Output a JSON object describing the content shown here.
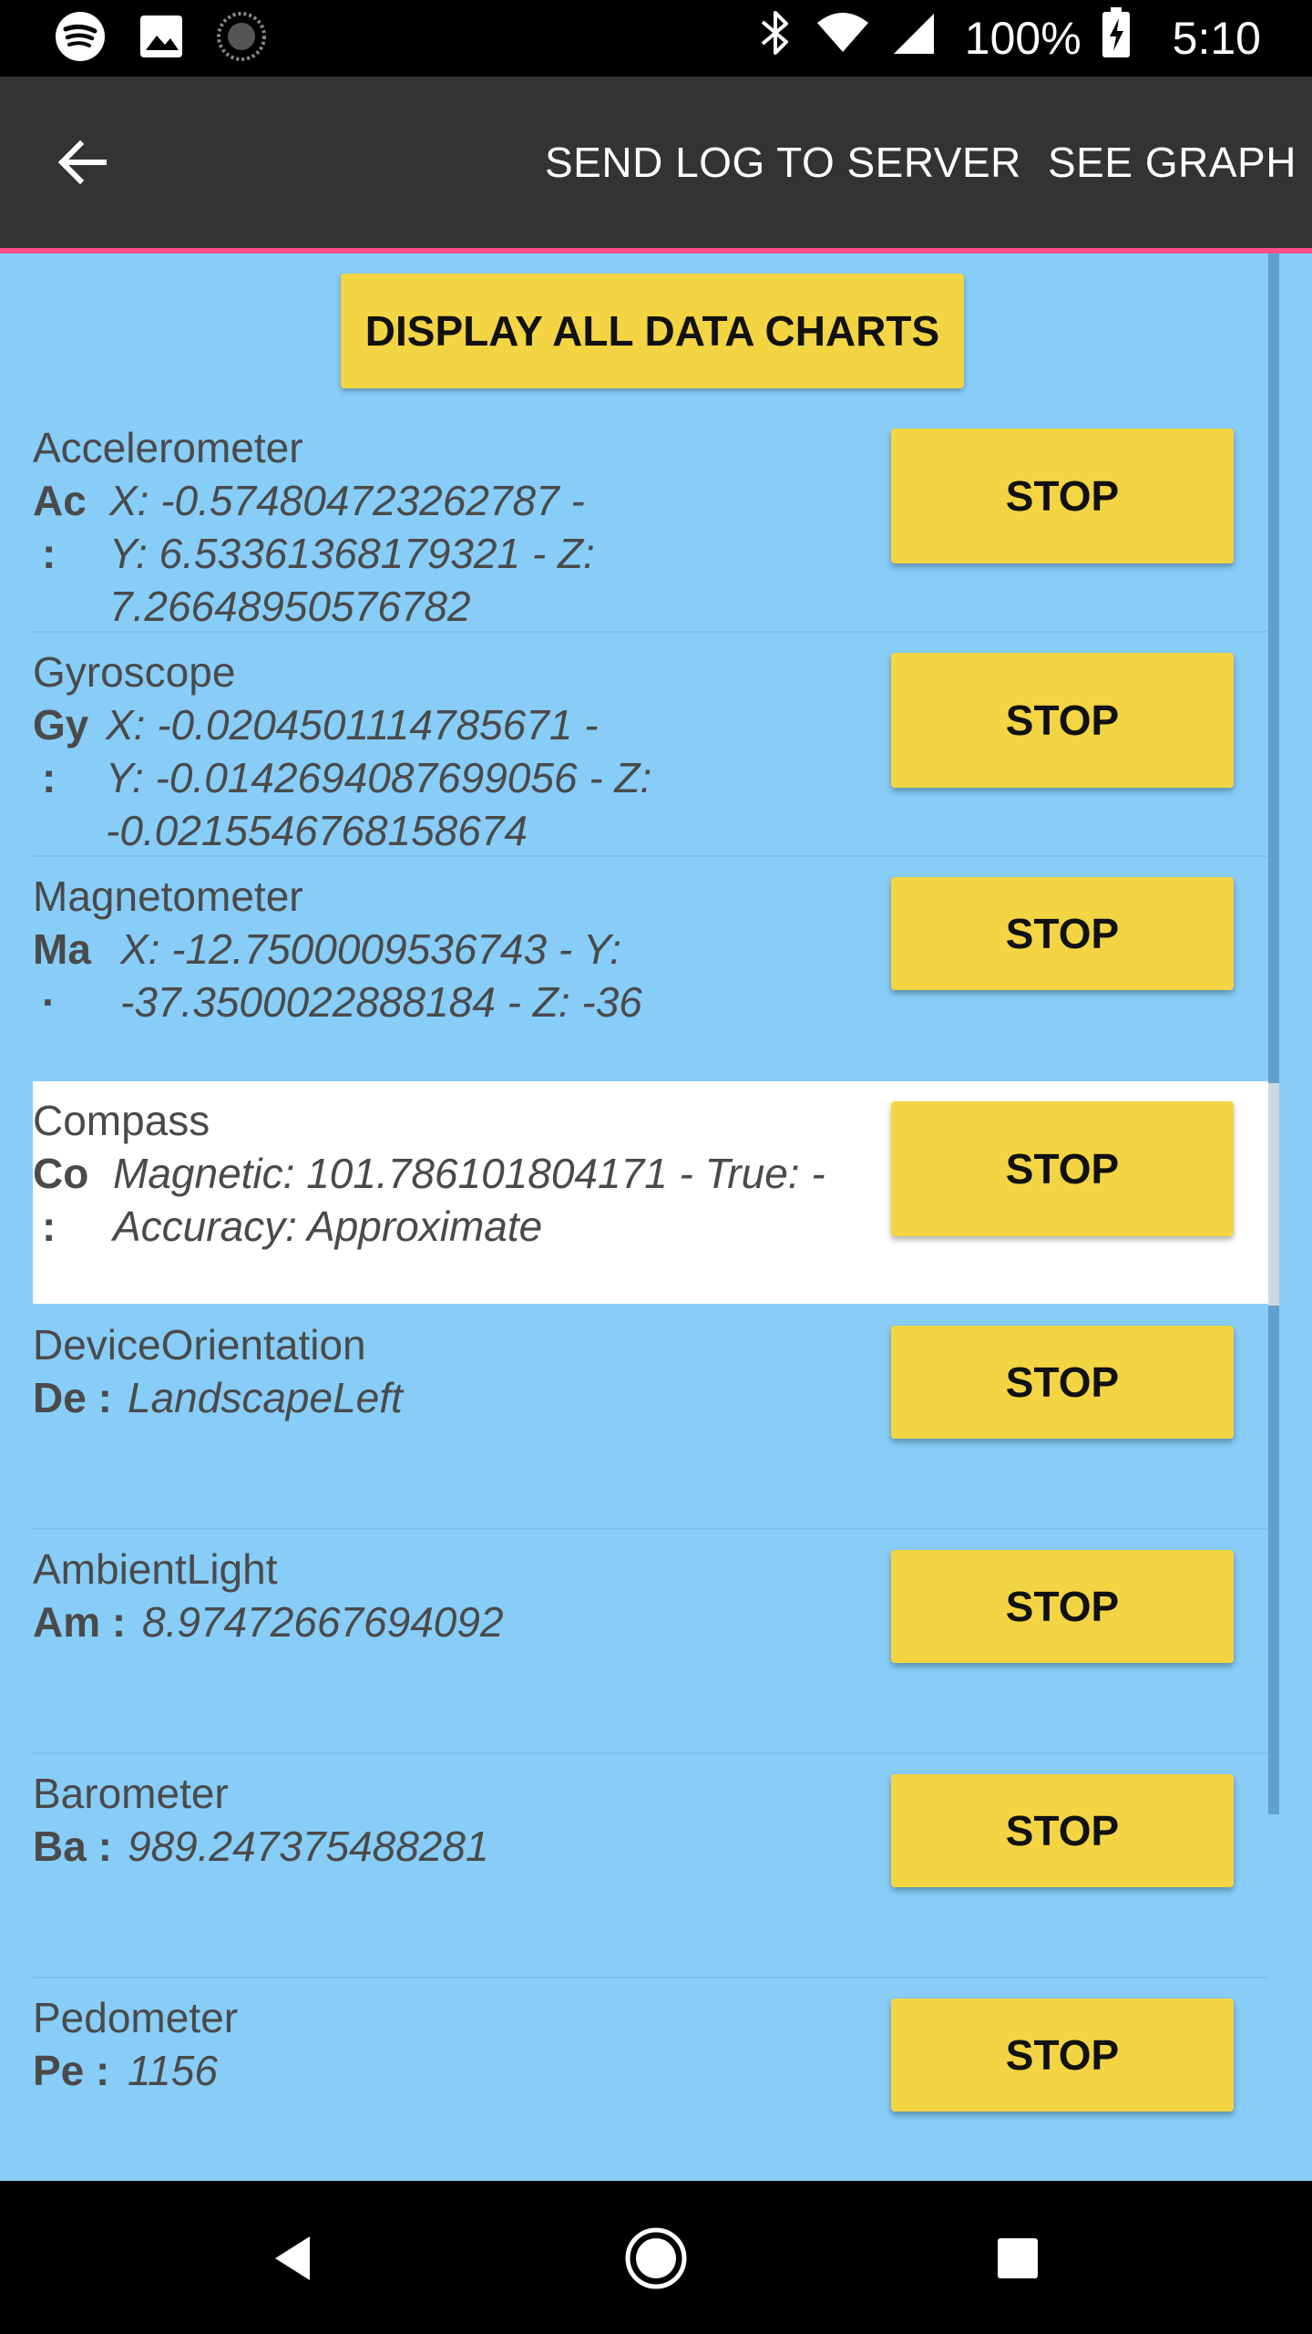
{
  "status_bar": {
    "battery": "100%",
    "time": "5:10",
    "icons": [
      "spotify-icon",
      "image-icon",
      "loading-icon",
      "bluetooth-icon",
      "wifi-icon",
      "signal-icon",
      "battery-charging-icon"
    ]
  },
  "toolbar": {
    "back_icon": "arrow-back-icon",
    "send_log": "SEND LOG TO SERVER",
    "see_graph": "SEE GRAPH"
  },
  "display_all_label": "DISPLAY ALL DATA CHARTS",
  "sensors": [
    {
      "name": "Accelerometer",
      "abbr": [
        "Ac",
        ":"
      ],
      "value": [
        "X: -0.574804723262787 -",
        "Y: 6.53361368179321 - Z:",
        "7.26648950576782"
      ],
      "button": "STOP"
    },
    {
      "name": "Gyroscope",
      "abbr": [
        "Gy",
        ":"
      ],
      "value": [
        "X: -0.0204501114785671 -",
        "Y: -0.0142694087699056 - Z:",
        "-0.0215546768158674"
      ],
      "button": "STOP"
    },
    {
      "name": "Magnetometer",
      "abbr": [
        "Ma",
        "·"
      ],
      "value": [
        "X: -12.7500009536743 - Y:",
        "-37.3500022888184 - Z: -36"
      ],
      "button": "STOP"
    },
    {
      "name": "Compass",
      "abbr": [
        "Co",
        ":"
      ],
      "value": [
        "Magnetic: 101.786101804171 - True:  -",
        "Accuracy: Approximate"
      ],
      "button": "STOP"
    },
    {
      "name": "DeviceOrientation",
      "abbr": [
        "De :"
      ],
      "value": [
        "LandscapeLeft"
      ],
      "button": "STOP"
    },
    {
      "name": "AmbientLight",
      "abbr": [
        "Am :"
      ],
      "value": [
        "8.97472667694092"
      ],
      "button": "STOP"
    },
    {
      "name": "Barometer",
      "abbr": [
        "Ba :"
      ],
      "value": [
        "989.247375488281"
      ],
      "button": "STOP"
    },
    {
      "name": "Pedometer",
      "abbr": [
        "Pe :"
      ],
      "value": [
        "1156"
      ],
      "button": "STOP"
    }
  ],
  "colors": {
    "content_bg": "#87cdf8",
    "toolbar_bg": "#333333",
    "accent_pink": "#ff4f8b",
    "button_yellow": "#f3d443"
  }
}
